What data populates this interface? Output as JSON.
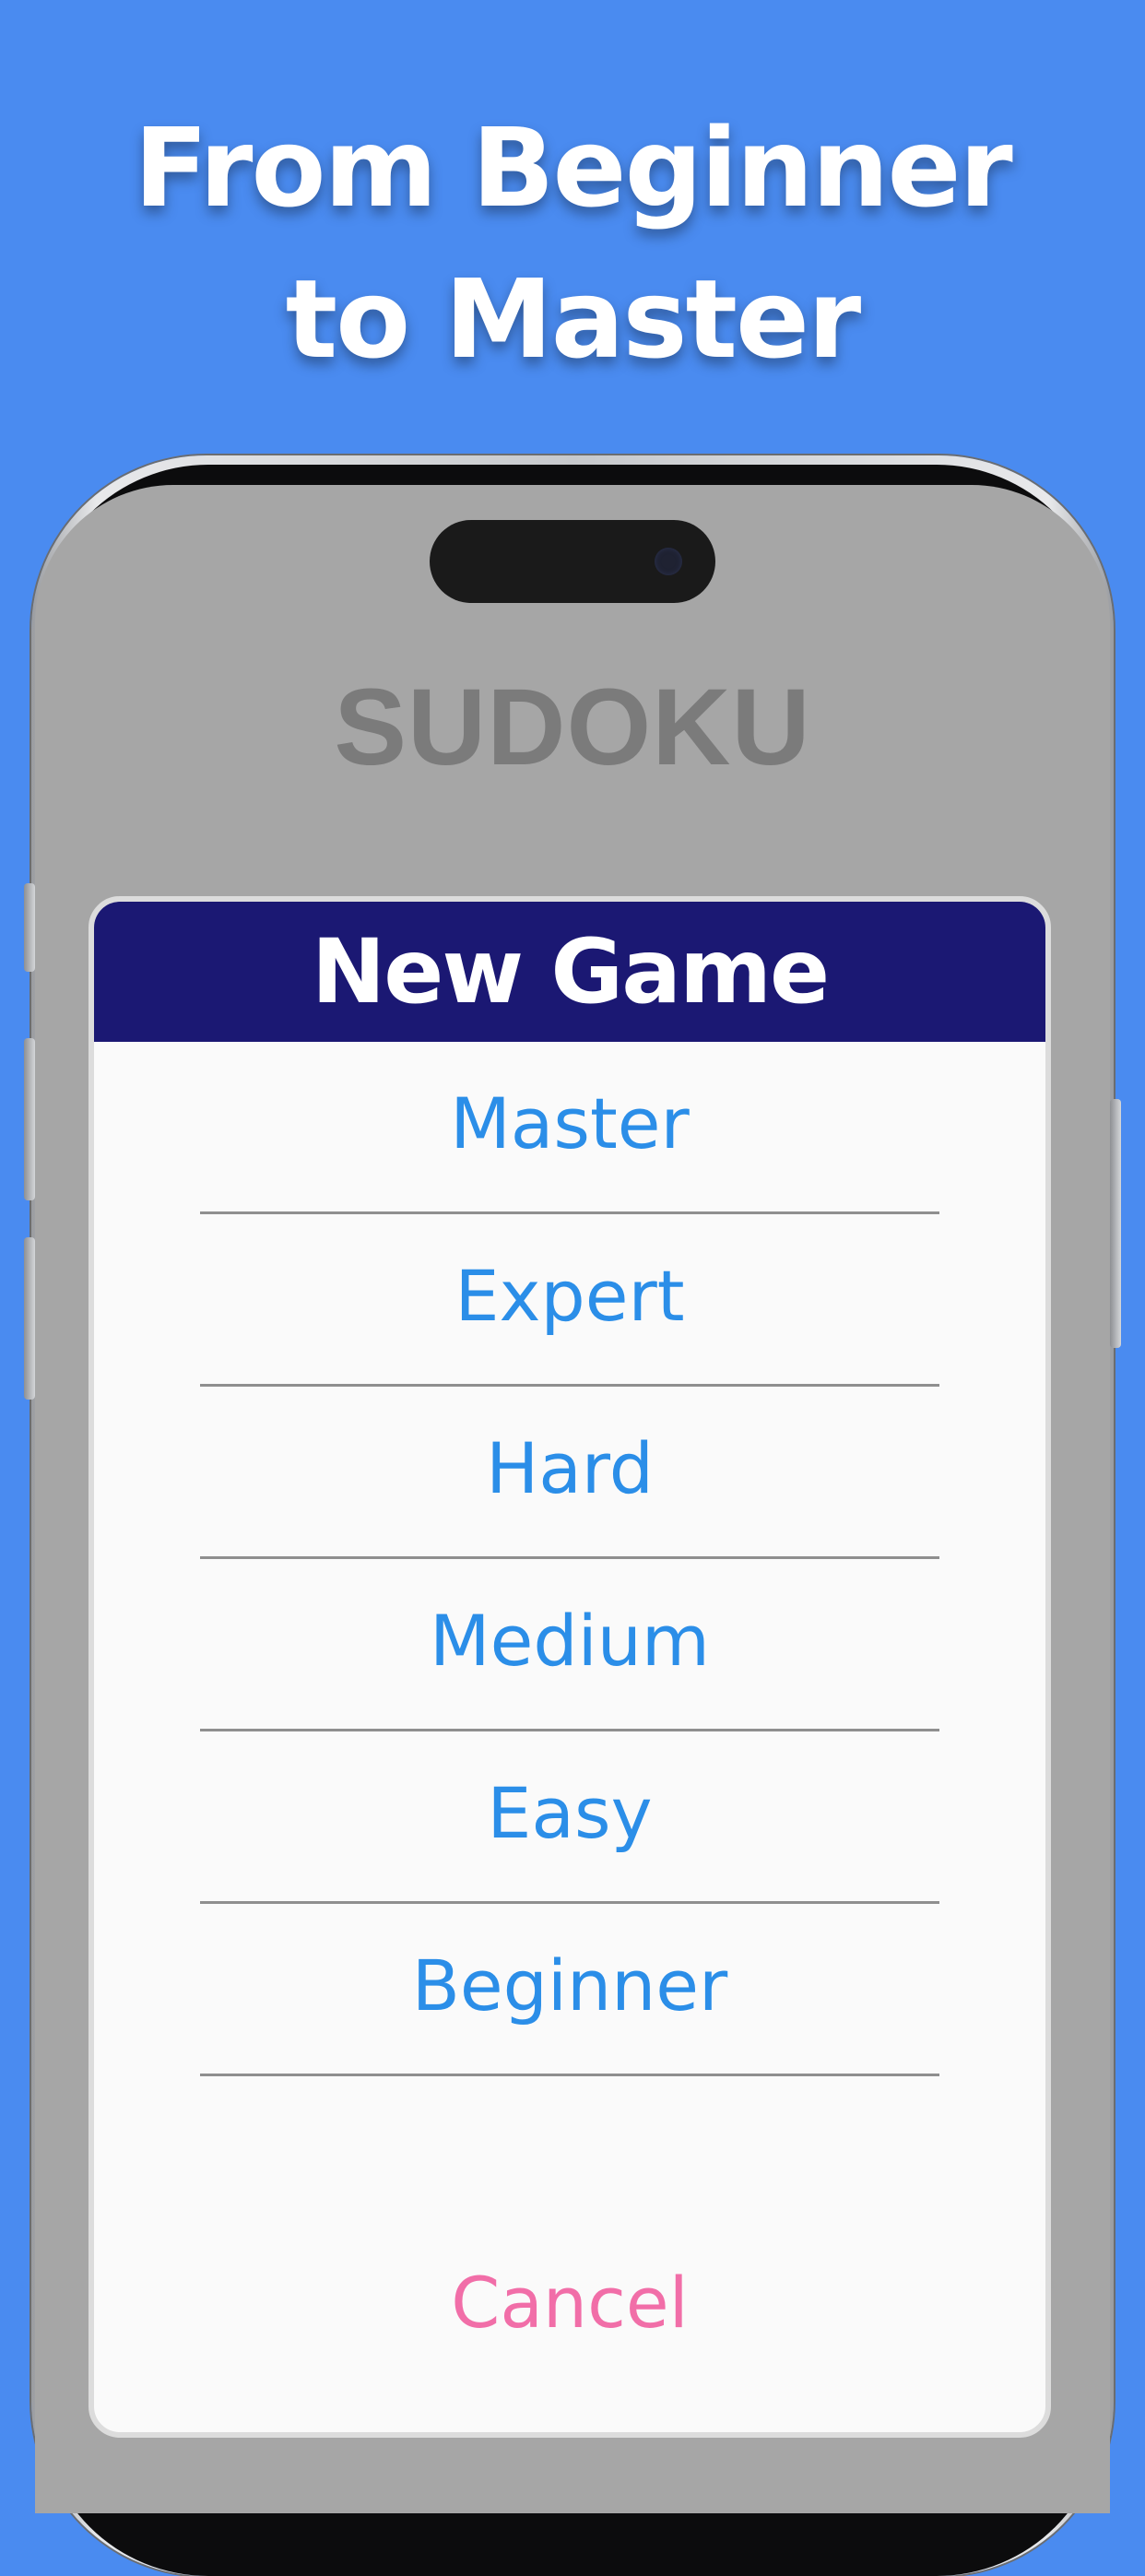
{
  "banner": {
    "line1": "From Beginner",
    "line2": "to Master"
  },
  "app": {
    "title": "SUDOKU"
  },
  "dialog": {
    "title": "New Game",
    "options": [
      {
        "label": "Master"
      },
      {
        "label": "Expert"
      },
      {
        "label": "Hard"
      },
      {
        "label": "Medium"
      },
      {
        "label": "Easy"
      },
      {
        "label": "Beginner"
      }
    ],
    "cancel_label": "Cancel"
  },
  "colors": {
    "background": "#4a8bf0",
    "dialog_header": "#1b1873",
    "option_text": "#2b8ee8",
    "cancel_text": "#f16ea8"
  }
}
